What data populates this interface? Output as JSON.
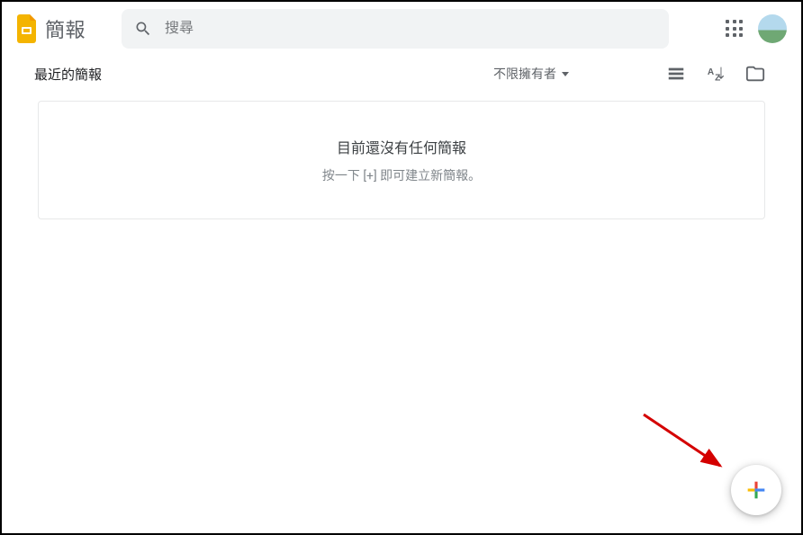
{
  "header": {
    "app_title": "簡報",
    "search_placeholder": "搜尋"
  },
  "toolbar": {
    "section_title": "最近的簡報",
    "owner_filter_label": "不限擁有者"
  },
  "empty_state": {
    "title": "目前還沒有任何簡報",
    "subtitle": "按一下 [+] 即可建立新簡報。"
  }
}
